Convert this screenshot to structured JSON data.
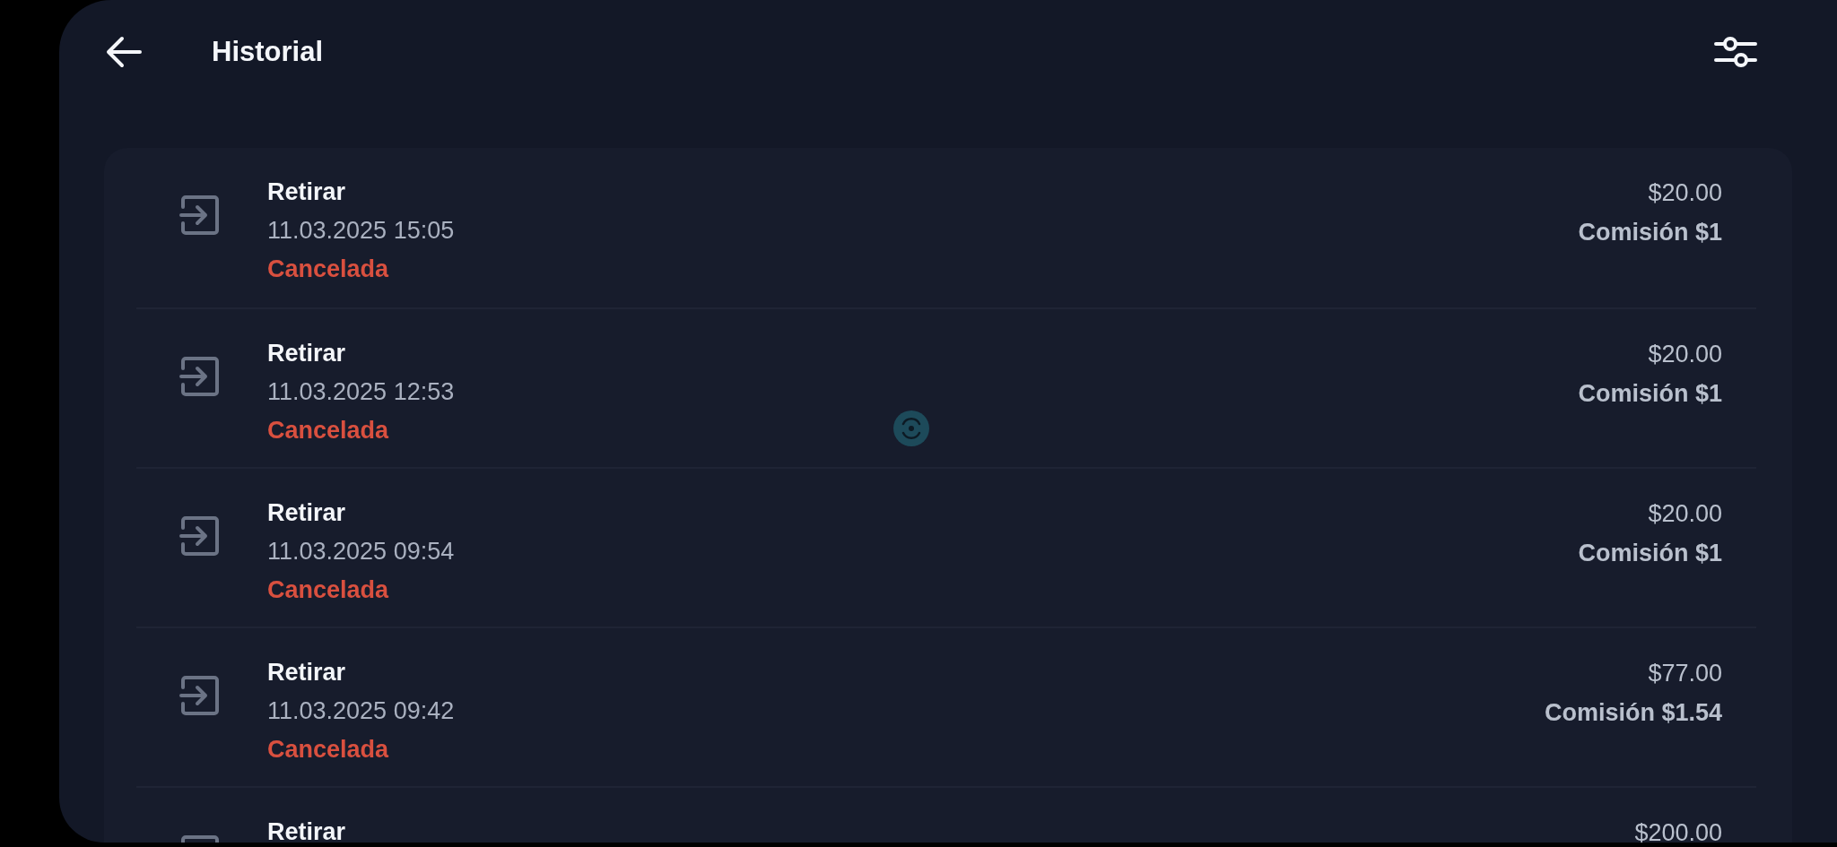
{
  "header": {
    "title": "Historial"
  },
  "loading": true,
  "transactions": [
    {
      "type": "Retirar",
      "date": "11.03.2025 15:05",
      "status": "Cancelada",
      "kind": "cancelled",
      "amount": "$20.00",
      "fee": "Comisión $1"
    },
    {
      "type": "Retirar",
      "date": "11.03.2025 12:53",
      "status": "Cancelada",
      "kind": "cancelled",
      "amount": "$20.00",
      "fee": "Comisión $1"
    },
    {
      "type": "Retirar",
      "date": "11.03.2025 09:54",
      "status": "Cancelada",
      "kind": "cancelled",
      "amount": "$20.00",
      "fee": "Comisión $1"
    },
    {
      "type": "Retirar",
      "date": "11.03.2025 09:42",
      "status": "Cancelada",
      "kind": "cancelled",
      "amount": "$77.00",
      "fee": "Comisión $1.54"
    },
    {
      "type": "Retirar",
      "amount": "$200.00"
    }
  ]
}
